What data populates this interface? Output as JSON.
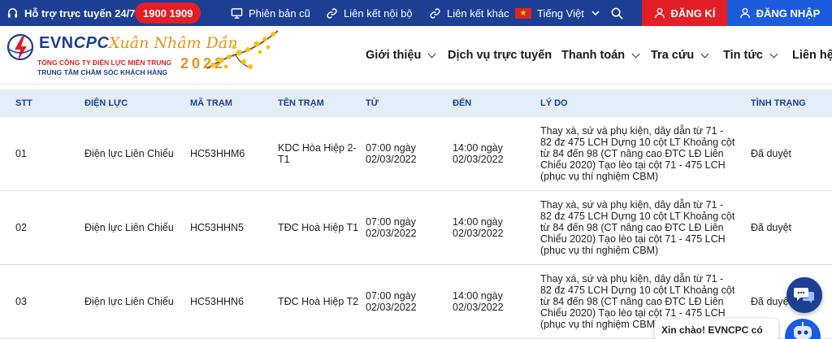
{
  "topbar": {
    "hotline_label": "Hỗ trợ trực tuyến 24/7:",
    "hotline_number": "1900 1909",
    "old_version": "Phiên bản cũ",
    "internal_links": "Liên kết nội bộ",
    "external_links": "Liên kết khác",
    "language": "Tiếng Việt",
    "register": "ĐĂNG KÍ",
    "login": "ĐĂNG NHẬP"
  },
  "header": {
    "brand_evn": "EVN",
    "brand_cpc": "CPC",
    "org_line1": "TỔNG CÔNG TY ĐIỆN LỰC MIỀN TRUNG",
    "org_line2": "TRUNG TÂM CHĂM SÓC KHÁCH HÀNG",
    "tet_greeting": "Xuân Nhâm Dần",
    "year": "2022",
    "nav": [
      "Giới thiệu",
      "Dịch vụ trực tuyến",
      "Thanh toán",
      "Tra cứu",
      "Tin tức",
      "Liên hệ"
    ]
  },
  "table": {
    "headers": [
      "STT",
      "ĐIỆN LỰC",
      "MÃ TRẠM",
      "TÊN TRẠM",
      "TỪ",
      "ĐẾN",
      "LÝ DO",
      "TÌNH TRẠNG"
    ],
    "rows": [
      {
        "stt": "01",
        "dien_luc": "Điện lực Liên Chiểu",
        "ma_tram": "HC53HHM6",
        "ten_tram": "KDC Hòa Hiệp 2-T1",
        "tu": "07:00 ngày 02/03/2022",
        "den": "14:00 ngày 02/03/2022",
        "ly_do": "Thay xà, sứ và phụ kiện, dây dẫn từ 71 - 82 đz 475 LCH Dựng 10 cột LT Khoảng cột từ 84 đến 98 (CT nâng cao ĐTC LĐ Liên Chiểu 2020) Tạo lèo tại cột 71 - 475 LCH (phục vụ thí nghiệm CBM)",
        "tinh_trang": "Đã duyệt"
      },
      {
        "stt": "02",
        "dien_luc": "Điện lực Liên Chiểu",
        "ma_tram": "HC53HHN5",
        "ten_tram": "TĐC Hoà Hiệp T1",
        "tu": "07:00 ngày 02/03/2022",
        "den": "14:00 ngày 02/03/2022",
        "ly_do": "Thay xà, sứ và phụ kiện, dây dẫn từ 71 - 82 đz 475 LCH Dựng 10 cột LT Khoảng cột từ 84 đến 98 (CT nâng cao ĐTC LĐ Liên Chiểu 2020) Tạo lèo tại cột 71 - 475 LCH (phục vụ thí nghiệm CBM)",
        "tinh_trang": "Đã duyệt"
      },
      {
        "stt": "03",
        "dien_luc": "Điện lực Liên Chiểu",
        "ma_tram": "HC53HHN6",
        "ten_tram": "TĐC Hoà Hiệp T2",
        "tu": "07:00 ngày 02/03/2022",
        "den": "14:00 ngày 02/03/2022",
        "ly_do": "Thay xà, sứ và phụ kiện, dây dẫn từ 71 - 82 đz 475 LCH Dựng 10 cột LT Khoảng cột từ 84 đến 98 (CT nâng cao ĐTC LĐ Liên Chiểu 2020) Tạo lèo tại cột 71 - 475 LCH (phục vụ thí nghiệm CBM)",
        "tinh_trang": "Đã duyệt"
      }
    ]
  },
  "chat": {
    "greeting": "Xin chào! EVNCPC có"
  },
  "colors": {
    "primary": "#1c3f94",
    "accent_red": "#e21f26",
    "login_blue": "#1c5cdc",
    "table_header_bg": "#e4eef9",
    "gold": "#e8931a"
  },
  "icons": [
    "headset-icon",
    "monitor-icon",
    "link-icon",
    "vietnam-flag-icon",
    "chevron-down-icon",
    "search-icon",
    "user-icon",
    "chat-icon",
    "chatbot-icon"
  ]
}
